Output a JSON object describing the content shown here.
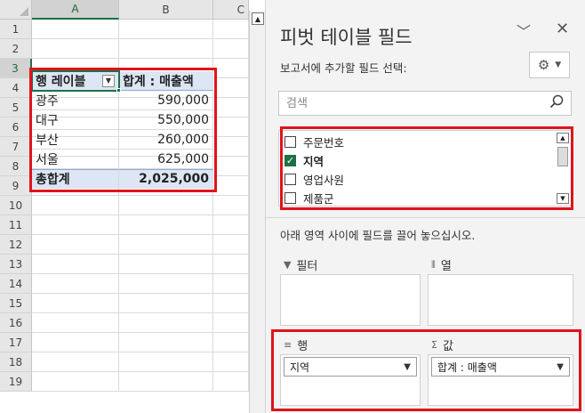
{
  "sheet": {
    "columns": [
      "A",
      "B",
      "C"
    ],
    "rows": [
      "1",
      "2",
      "3",
      "4",
      "5",
      "6",
      "7",
      "8",
      "9",
      "10",
      "11",
      "12",
      "13",
      "14",
      "15",
      "16",
      "17",
      "18",
      "19"
    ],
    "pivot": {
      "row_label_header": "행 레이블",
      "value_header": "합계 : 매출액",
      "rows": [
        {
          "label": "광주",
          "value": "590,000"
        },
        {
          "label": "대구",
          "value": "550,000"
        },
        {
          "label": "부산",
          "value": "260,000"
        },
        {
          "label": "서울",
          "value": "625,000"
        }
      ],
      "total_label": "총합계",
      "total_value": "2,025,000"
    }
  },
  "pane": {
    "title": "피벗 테이블 필드",
    "subtitle": "보고서에 추가할 필드 선택:",
    "search_placeholder": "검색",
    "fields": [
      {
        "name": "주문번호",
        "checked": false
      },
      {
        "name": "지역",
        "checked": true
      },
      {
        "name": "영업사원",
        "checked": false
      },
      {
        "name": "제품군",
        "checked": false
      }
    ],
    "drag_hint": "아래 영역 사이에 필드를 끌어 놓으십시오.",
    "areas": {
      "filter_label": "필터",
      "column_label": "열",
      "row_label": "행",
      "value_label": "값",
      "row_item": "지역",
      "value_item": "합계 : 매출액"
    }
  },
  "colors": {
    "accent": "#1e7145",
    "highlight_box": "#e0131a",
    "pivot_header_bg": "#dce6f4"
  }
}
